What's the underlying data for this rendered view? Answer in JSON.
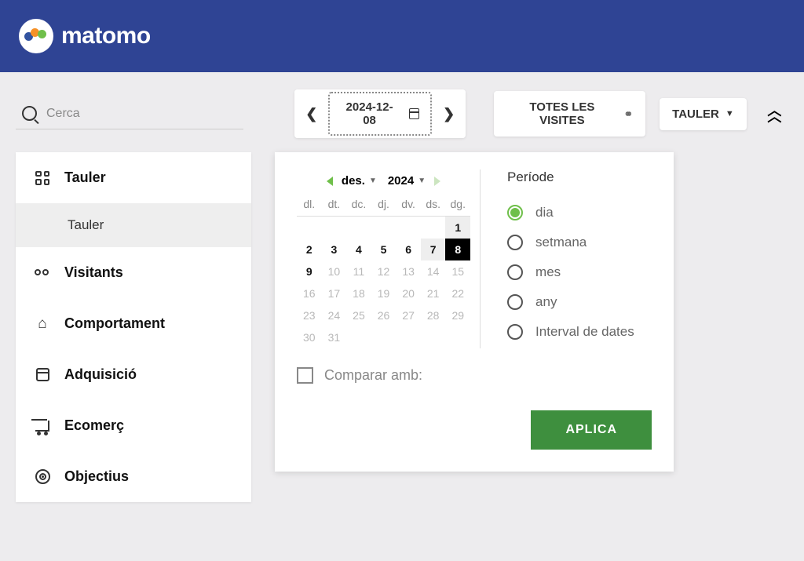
{
  "app": {
    "name": "matomo"
  },
  "search": {
    "placeholder": "Cerca"
  },
  "toolbar": {
    "date": "2024-12-08",
    "segment": "TOTES LES VISITES",
    "view": "TAULER"
  },
  "nav": {
    "items": [
      {
        "id": "dashboard",
        "label": "Tauler",
        "active": true,
        "sub": [
          {
            "label": "Tauler"
          }
        ]
      },
      {
        "id": "visitors",
        "label": "Visitants"
      },
      {
        "id": "behaviour",
        "label": "Comportament"
      },
      {
        "id": "acquisition",
        "label": "Adquisició"
      },
      {
        "id": "ecommerce",
        "label": "Ecomerç"
      },
      {
        "id": "goals",
        "label": "Objectius"
      }
    ]
  },
  "datepicker": {
    "month_label": "des.",
    "year_label": "2024",
    "weekdays": [
      "dl.",
      "dt.",
      "dc.",
      "dj.",
      "dv.",
      "ds.",
      "dg."
    ],
    "weeks": [
      [
        null,
        null,
        null,
        null,
        null,
        null,
        {
          "d": 1,
          "a": true,
          "h": true
        }
      ],
      [
        {
          "d": 2,
          "a": true
        },
        {
          "d": 3,
          "a": true
        },
        {
          "d": 4,
          "a": true
        },
        {
          "d": 5,
          "a": true
        },
        {
          "d": 6,
          "a": true
        },
        {
          "d": 7,
          "a": true,
          "h": true
        },
        {
          "d": 8,
          "a": true,
          "sel": true
        }
      ],
      [
        {
          "d": 9,
          "a": true
        },
        {
          "d": 10
        },
        {
          "d": 11
        },
        {
          "d": 12
        },
        {
          "d": 13
        },
        {
          "d": 14
        },
        {
          "d": 15
        }
      ],
      [
        {
          "d": 16
        },
        {
          "d": 17
        },
        {
          "d": 18
        },
        {
          "d": 19
        },
        {
          "d": 20
        },
        {
          "d": 21
        },
        {
          "d": 22
        }
      ],
      [
        {
          "d": 23
        },
        {
          "d": 24
        },
        {
          "d": 25
        },
        {
          "d": 26
        },
        {
          "d": 27
        },
        {
          "d": 28
        },
        {
          "d": 29
        }
      ],
      [
        {
          "d": 30
        },
        {
          "d": 31
        },
        null,
        null,
        null,
        null,
        null
      ]
    ],
    "period_title": "Període",
    "periods": [
      {
        "id": "day",
        "label": "dia",
        "selected": true
      },
      {
        "id": "week",
        "label": "setmana"
      },
      {
        "id": "month",
        "label": "mes"
      },
      {
        "id": "year",
        "label": "any"
      },
      {
        "id": "range",
        "label": "Interval de dates"
      }
    ],
    "compare_label": "Comparar amb:",
    "apply_label": "APLICA"
  }
}
